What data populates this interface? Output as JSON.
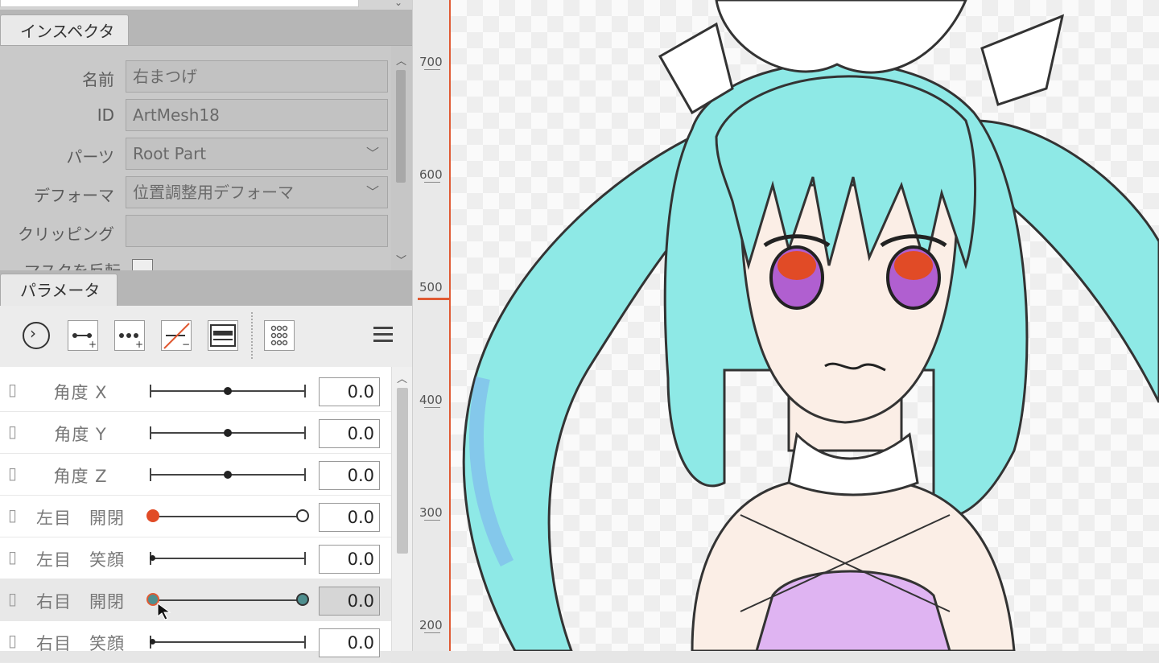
{
  "inspector": {
    "tab_label": "インスペクタ",
    "rows": [
      {
        "label": "名前",
        "value": "右まつげ"
      },
      {
        "label": "ID",
        "value": "ArtMesh18"
      },
      {
        "label": "パーツ",
        "value": "Root Part"
      },
      {
        "label": "デフォーマ",
        "value": "位置調整用デフォーマ"
      },
      {
        "label": "クリッピング",
        "value": ""
      }
    ],
    "partial_label": "マスクを反転"
  },
  "parameters": {
    "tab_label": "パラメータ",
    "toolbar_icons": [
      "play-circle-icon",
      "add-key-icon",
      "add-three-keys-icon",
      "delete-key-icon",
      "key-grid-icon",
      "key-matrix-icon",
      "menu-icon"
    ],
    "items": [
      {
        "name": "角度 X",
        "value": "0.0",
        "position": 0.5
      },
      {
        "name": "角度 Y",
        "value": "0.0",
        "position": 0.5
      },
      {
        "name": "角度 Z",
        "value": "0.0",
        "position": 0.5
      },
      {
        "name": "左目　開閉",
        "value": "0.0",
        "position": 0.0
      },
      {
        "name": "左目　笑顔",
        "value": "0.0",
        "position": 0.0
      },
      {
        "name": "右目　開閉",
        "value": "0.0",
        "position": 0.0
      },
      {
        "name": "右目　笑顔",
        "value": "0.0",
        "position": 0.0
      }
    ]
  },
  "ruler": {
    "labels": [
      "700",
      "600",
      "500",
      "400",
      "300",
      "200"
    ]
  },
  "colors": {
    "accent": "#e05a33",
    "hair": "#8ee9e6",
    "key_teal": "#4f8f8f"
  }
}
